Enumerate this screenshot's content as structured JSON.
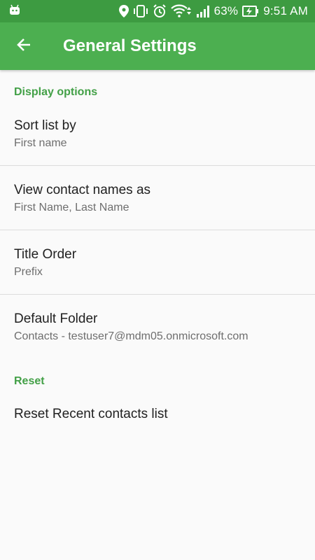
{
  "status_bar": {
    "battery": "63%",
    "time": "9:51 AM",
    "icons": [
      "android-icon",
      "location-icon",
      "vibrate-icon",
      "alarm-icon",
      "wifi-icon",
      "signal-icon",
      "battery-charging-icon"
    ]
  },
  "app_bar": {
    "back_icon": "arrow-back-icon",
    "title": "General Settings"
  },
  "sections": {
    "display": {
      "header": "Display options",
      "sort": {
        "title": "Sort list by",
        "summary": "First name"
      },
      "view_names": {
        "title": "View contact names as",
        "summary": "First Name, Last Name"
      },
      "title_order": {
        "title": "Title Order",
        "summary": "Prefix"
      },
      "default_folder": {
        "title": "Default Folder",
        "summary": "Contacts - testuser7@mdm05.onmicrosoft.com"
      }
    },
    "reset": {
      "header": "Reset",
      "reset_recent": {
        "title": "Reset Recent contacts list"
      }
    }
  },
  "colors": {
    "status_bar": "#3d9b41",
    "app_bar": "#4caf50",
    "accent": "#43a047",
    "background": "#fafafa"
  }
}
